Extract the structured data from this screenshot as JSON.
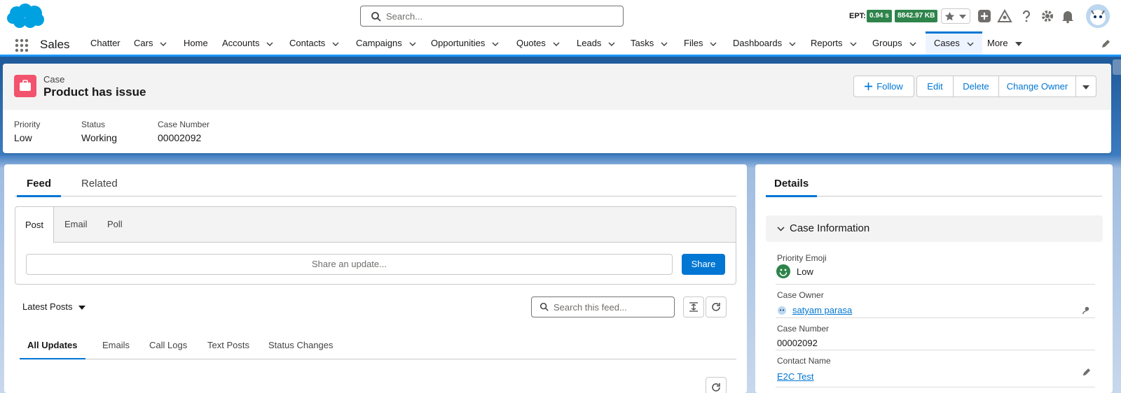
{
  "header": {
    "search_placeholder": "Search...",
    "ept_label": "EPT:",
    "ept_time": "0.94 s",
    "ept_size": "8842.97 KB"
  },
  "nav": {
    "app_name": "Sales",
    "items": [
      {
        "label": "Chatter",
        "has_menu": false
      },
      {
        "label": "Cars",
        "has_menu": true
      },
      {
        "label": "Home",
        "has_menu": false
      },
      {
        "label": "Accounts",
        "has_menu": true
      },
      {
        "label": "Contacts",
        "has_menu": true
      },
      {
        "label": "Campaigns",
        "has_menu": true
      },
      {
        "label": "Opportunities",
        "has_menu": true
      },
      {
        "label": "Quotes",
        "has_menu": true
      },
      {
        "label": "Leads",
        "has_menu": true
      },
      {
        "label": "Tasks",
        "has_menu": true
      },
      {
        "label": "Files",
        "has_menu": true
      },
      {
        "label": "Dashboards",
        "has_menu": true
      },
      {
        "label": "Reports",
        "has_menu": true
      },
      {
        "label": "Groups",
        "has_menu": true
      },
      {
        "label": "Cases",
        "has_menu": true,
        "active": true
      },
      {
        "label": "More",
        "has_menu": true
      }
    ]
  },
  "record": {
    "object_label": "Case",
    "title": "Product has issue",
    "actions": {
      "follow": "Follow",
      "edit": "Edit",
      "delete": "Delete",
      "change_owner": "Change Owner"
    },
    "highlights": [
      {
        "label": "Priority",
        "value": "Low"
      },
      {
        "label": "Status",
        "value": "Working"
      },
      {
        "label": "Case Number",
        "value": "00002092"
      }
    ]
  },
  "feed": {
    "tabs": [
      "Feed",
      "Related"
    ],
    "publisher_tabs": [
      "Post",
      "Email",
      "Poll"
    ],
    "share_placeholder": "Share an update...",
    "share_button": "Share",
    "sort_label": "Latest Posts",
    "search_placeholder": "Search this feed...",
    "filter_tabs": [
      "All Updates",
      "Emails",
      "Call Logs",
      "Text Posts",
      "Status Changes"
    ]
  },
  "details": {
    "tab": "Details",
    "section_title": "Case Information",
    "fields": [
      {
        "label": "Priority Emoji",
        "value": "Low"
      },
      {
        "label": "Case Owner",
        "value": "satyam parasa"
      },
      {
        "label": "Case Number",
        "value": "00002092"
      },
      {
        "label": "Contact Name",
        "value": "E2C Test"
      }
    ]
  },
  "colors": {
    "brand_blue": "#0176d3",
    "case_icon": "#f2536d",
    "ept_badge": "#2e844a",
    "emoji_green": "#2e844a"
  }
}
